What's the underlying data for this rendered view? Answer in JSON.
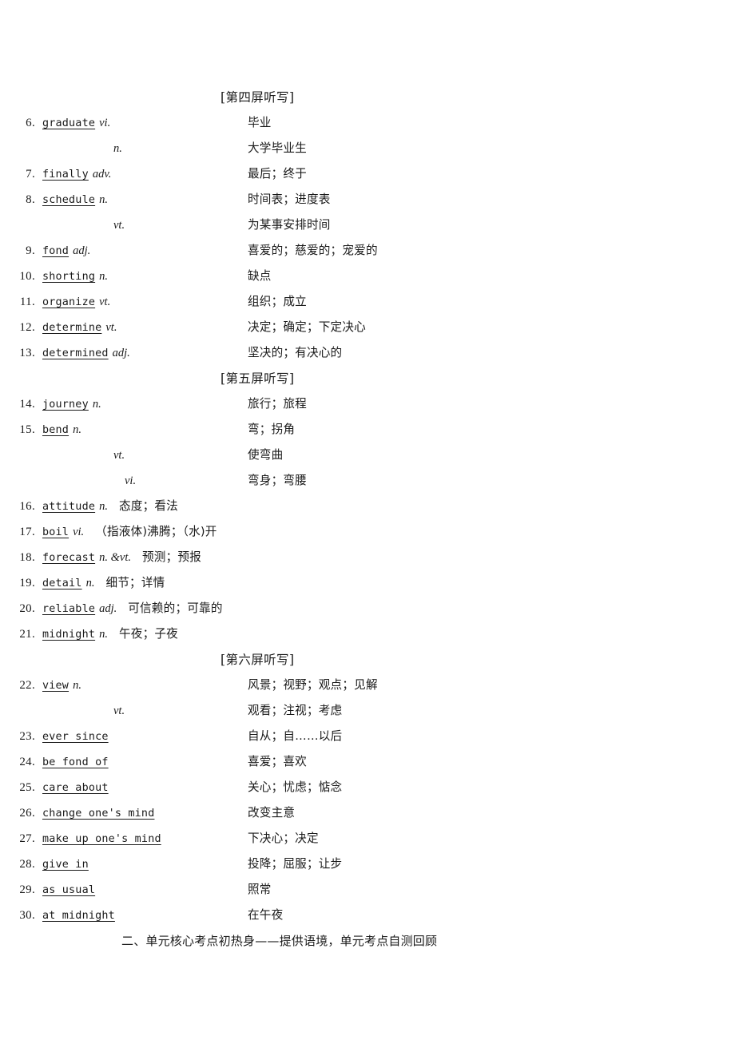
{
  "page": {
    "background": "#ffffff",
    "text_color": "#1a1a1a"
  },
  "sections": [
    {
      "header": "[第四屏听写]",
      "entries": [
        {
          "num": "6.",
          "word": "graduate",
          "pos": "vi.",
          "zh": "毕业"
        },
        {
          "num": "",
          "word": "",
          "pos": "n.",
          "zh": "大学毕业生",
          "sub": "n"
        },
        {
          "num": "7.",
          "word": "finally",
          "pos": "adv.",
          "zh": "最后；终于"
        },
        {
          "num": "8.",
          "word": "schedule",
          "pos": "n.",
          "zh": "时间表；进度表"
        },
        {
          "num": "",
          "word": "",
          "pos": "vt.",
          "zh": "为某事安排时间",
          "sub": "vt"
        },
        {
          "num": "9.",
          "word": "fond",
          "pos": "adj.",
          "zh": "喜爱的；慈爱的；宠爱的"
        },
        {
          "num": "10.",
          "word": "shorting",
          "pos": "n.",
          "zh": "缺点"
        },
        {
          "num": "11.",
          "word": "organize",
          "pos": "vt.",
          "zh": "组织；成立"
        },
        {
          "num": "12.",
          "word": "determine",
          "pos": "vt.",
          "zh": "决定；确定；下定决心"
        },
        {
          "num": "13.",
          "word": "determined",
          "pos": "adj.",
          "zh": "坚决的；有决心的"
        }
      ]
    },
    {
      "header": "[第五屏听写]",
      "entries": [
        {
          "num": "14.",
          "word": "journey",
          "pos": "n.",
          "zh": "旅行；旅程"
        },
        {
          "num": "15.",
          "word": "bend",
          "pos": "n.",
          "zh": "弯；拐角"
        },
        {
          "num": "",
          "word": "",
          "pos": "vt.",
          "zh": "使弯曲",
          "sub": "vt"
        },
        {
          "num": "",
          "word": "",
          "pos": "vi.",
          "zh": "弯身；弯腰",
          "sub": "vi"
        },
        {
          "num": "16.",
          "word": "attitude",
          "pos": "n.",
          "zh": "态度；看法",
          "inline": true
        },
        {
          "num": "17.",
          "word": "boil",
          "pos": "vi.",
          "zh": "（指液体)沸腾；（水)开",
          "inline": true
        },
        {
          "num": "18.",
          "word": "forecast",
          "pos": "n. &vt.",
          "zh": "预测；预报",
          "inline": true
        },
        {
          "num": "19.",
          "word": "detail",
          "pos": "n.",
          "zh": "细节；详情",
          "inline": true
        },
        {
          "num": "20.",
          "word": "reliable",
          "pos": "adj.",
          "zh": "可信赖的；可靠的",
          "inline": true
        },
        {
          "num": "21.",
          "word": "midnight",
          "pos": "n.",
          "zh": "午夜；子夜",
          "inline": true
        }
      ]
    },
    {
      "header": "[第六屏听写]",
      "entries": [
        {
          "num": "22.",
          "word": "view",
          "pos": "n.",
          "zh": "风景；视野；观点；见解"
        },
        {
          "num": "",
          "word": "",
          "pos": "vt.",
          "zh": "观看；注视；考虑",
          "sub": "vt"
        },
        {
          "num": "23.",
          "word": "ever since",
          "pos": "",
          "zh": "自从；自……以后"
        },
        {
          "num": "24.",
          "word": "be fond of",
          "pos": "",
          "zh": "喜爱；喜欢"
        },
        {
          "num": "25.",
          "word": "care about",
          "pos": "",
          "zh": "关心；忧虑；惦念"
        },
        {
          "num": "26.",
          "word": "change one's mind",
          "pos": "",
          "zh": "改变主意"
        },
        {
          "num": "27.",
          "word": "make up one's mind",
          "pos": "",
          "zh": "下决心；决定"
        },
        {
          "num": "28.",
          "word": "give in",
          "pos": "",
          "zh": "投降；屈服；让步"
        },
        {
          "num": "29.",
          "word": "as usual",
          "pos": "",
          "zh": "照常"
        },
        {
          "num": "30.",
          "word": "at midnight",
          "pos": "",
          "zh": "在午夜"
        }
      ]
    }
  ],
  "footer": {
    "heading": "二、单元核心考点初热身——提供语境，单元考点自测回顾"
  }
}
